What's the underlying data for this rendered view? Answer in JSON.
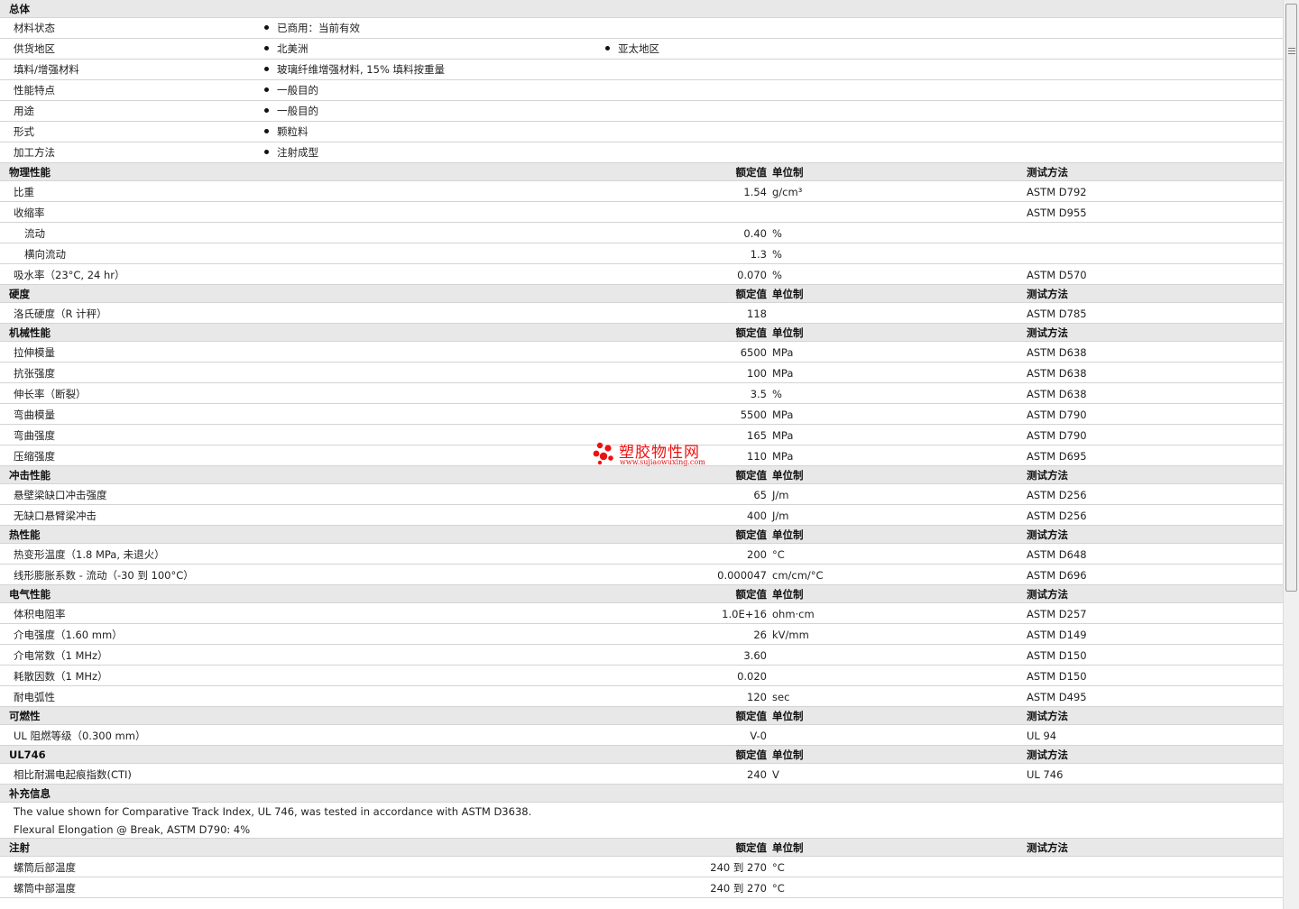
{
  "general": {
    "title": "总体",
    "rows": [
      {
        "name": "材料状态",
        "items": [
          "已商用：当前有效"
        ]
      },
      {
        "name": "供货地区",
        "items": [
          "北美洲",
          "亚太地区"
        ]
      },
      {
        "name": "填料/增强材料",
        "items": [
          "玻璃纤维增强材料, 15% 填料按重量"
        ]
      },
      {
        "name": "性能特点",
        "items": [
          "一般目的"
        ]
      },
      {
        "name": "用途",
        "items": [
          "一般目的"
        ]
      },
      {
        "name": "形式",
        "items": [
          "颗粒料"
        ]
      },
      {
        "name": "加工方法",
        "items": [
          "注射成型"
        ]
      }
    ]
  },
  "headers": {
    "value": "额定值",
    "unit": "单位制",
    "test": "测试方法"
  },
  "sections": [
    {
      "title": "物理性能",
      "rows": [
        {
          "name": "比重",
          "value": "1.54",
          "unit": "g/cm³",
          "test": "ASTM D792"
        },
        {
          "name": "收缩率",
          "value": "",
          "unit": "",
          "test": "ASTM D955"
        },
        {
          "name": "流动",
          "value": "0.40",
          "unit": "%",
          "test": "",
          "sub": true
        },
        {
          "name": "横向流动",
          "value": "1.3",
          "unit": "%",
          "test": "",
          "sub": true
        },
        {
          "name": "吸水率（23°C, 24 hr）",
          "value": "0.070",
          "unit": "%",
          "test": "ASTM D570"
        }
      ]
    },
    {
      "title": "硬度",
      "rows": [
        {
          "name": "洛氏硬度（R 计秤）",
          "value": "118",
          "unit": "",
          "test": "ASTM D785"
        }
      ]
    },
    {
      "title": "机械性能",
      "rows": [
        {
          "name": "拉伸模量",
          "value": "6500",
          "unit": "MPa",
          "test": "ASTM D638"
        },
        {
          "name": "抗张强度",
          "value": "100",
          "unit": "MPa",
          "test": "ASTM D638"
        },
        {
          "name": "伸长率（断裂）",
          "value": "3.5",
          "unit": "%",
          "test": "ASTM D638"
        },
        {
          "name": "弯曲模量",
          "value": "5500",
          "unit": "MPa",
          "test": "ASTM D790"
        },
        {
          "name": "弯曲强度",
          "value": "165",
          "unit": "MPa",
          "test": "ASTM D790"
        },
        {
          "name": "压缩强度",
          "value": "110",
          "unit": "MPa",
          "test": "ASTM D695"
        }
      ]
    },
    {
      "title": "冲击性能",
      "rows": [
        {
          "name": "悬壁梁缺口冲击强度",
          "value": "65",
          "unit": "J/m",
          "test": "ASTM D256"
        },
        {
          "name": "无缺口悬臂梁冲击",
          "value": "400",
          "unit": "J/m",
          "test": "ASTM D256"
        }
      ]
    },
    {
      "title": "热性能",
      "rows": [
        {
          "name": "热变形温度（1.8 MPa, 未退火）",
          "value": "200",
          "unit": "°C",
          "test": "ASTM D648"
        },
        {
          "name": "线形膨胀系数 - 流动（-30 到 100°C）",
          "value": "0.000047",
          "unit": "cm/cm/°C",
          "test": "ASTM D696"
        }
      ]
    },
    {
      "title": "电气性能",
      "rows": [
        {
          "name": "体积电阻率",
          "value": "1.0E+16",
          "unit": "ohm·cm",
          "test": "ASTM D257"
        },
        {
          "name": "介电强度（1.60 mm）",
          "value": "26",
          "unit": "kV/mm",
          "test": "ASTM D149"
        },
        {
          "name": "介电常数（1 MHz）",
          "value": "3.60",
          "unit": "",
          "test": "ASTM D150"
        },
        {
          "name": "耗散因数（1 MHz）",
          "value": "0.020",
          "unit": "",
          "test": "ASTM D150"
        },
        {
          "name": "耐电弧性",
          "value": "120",
          "unit": "sec",
          "test": "ASTM D495"
        }
      ]
    },
    {
      "title": "可燃性",
      "rows": [
        {
          "name": "UL 阻燃等级（0.300 mm）",
          "value": "V-0",
          "unit": "",
          "test": "UL 94"
        }
      ]
    },
    {
      "title": "UL746",
      "rows": [
        {
          "name": "相比耐漏电起痕指数(CTI)",
          "value": "240",
          "unit": "V",
          "test": "UL 746"
        }
      ]
    }
  ],
  "supplementary": {
    "title": "补充信息",
    "notes": [
      "The value shown for Comparative Track Index, UL 746, was tested in accordance with ASTM D3638.",
      "Flexural Elongation @ Break, ASTM D790: 4%"
    ]
  },
  "injection": {
    "title": "注射",
    "rows": [
      {
        "name": "螺筒后部温度",
        "value": "240 到  270",
        "unit": "°C",
        "test": ""
      },
      {
        "name": "螺筒中部温度",
        "value": "240 到  270",
        "unit": "°C",
        "test": ""
      }
    ]
  },
  "watermark": {
    "text": "塑胶物性网",
    "url": "www.sujiaowuxing.com",
    "color": "#ee1111"
  }
}
